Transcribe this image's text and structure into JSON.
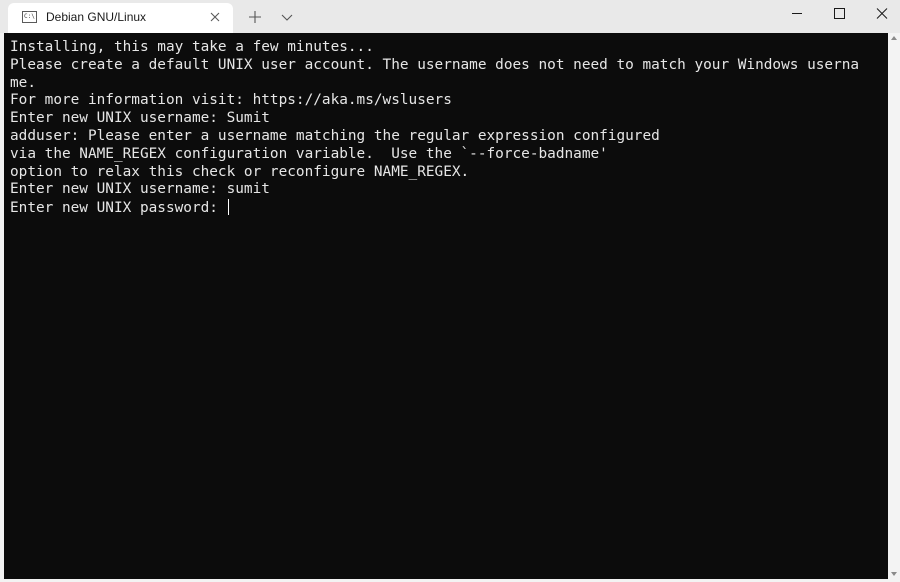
{
  "tab": {
    "title": "Debian GNU/Linux",
    "icon": "terminal-icon",
    "icon_text": "C:\\"
  },
  "titlebar": {
    "new_tab_icon": "plus-icon",
    "dropdown_icon": "chevron-down-icon",
    "minimize_icon": "minimize-icon",
    "maximize_icon": "maximize-icon",
    "close_icon": "close-icon"
  },
  "terminal": {
    "lines": [
      "Installing, this may take a few minutes...",
      "Please create a default UNIX user account. The username does not need to match your Windows userna",
      "me.",
      "For more information visit: https://aka.ms/wslusers",
      "Enter new UNIX username: Sumit",
      "adduser: Please enter a username matching the regular expression configured",
      "via the NAME_REGEX configuration variable.  Use the `--force-badname'",
      "option to relax this check or reconfigure NAME_REGEX.",
      "Enter new UNIX username: sumit",
      "Enter new UNIX password: "
    ]
  },
  "colors": {
    "terminal_bg": "#0c0c0c",
    "terminal_fg": "#e6e6e6",
    "chrome_bg": "#f3f3f3"
  }
}
